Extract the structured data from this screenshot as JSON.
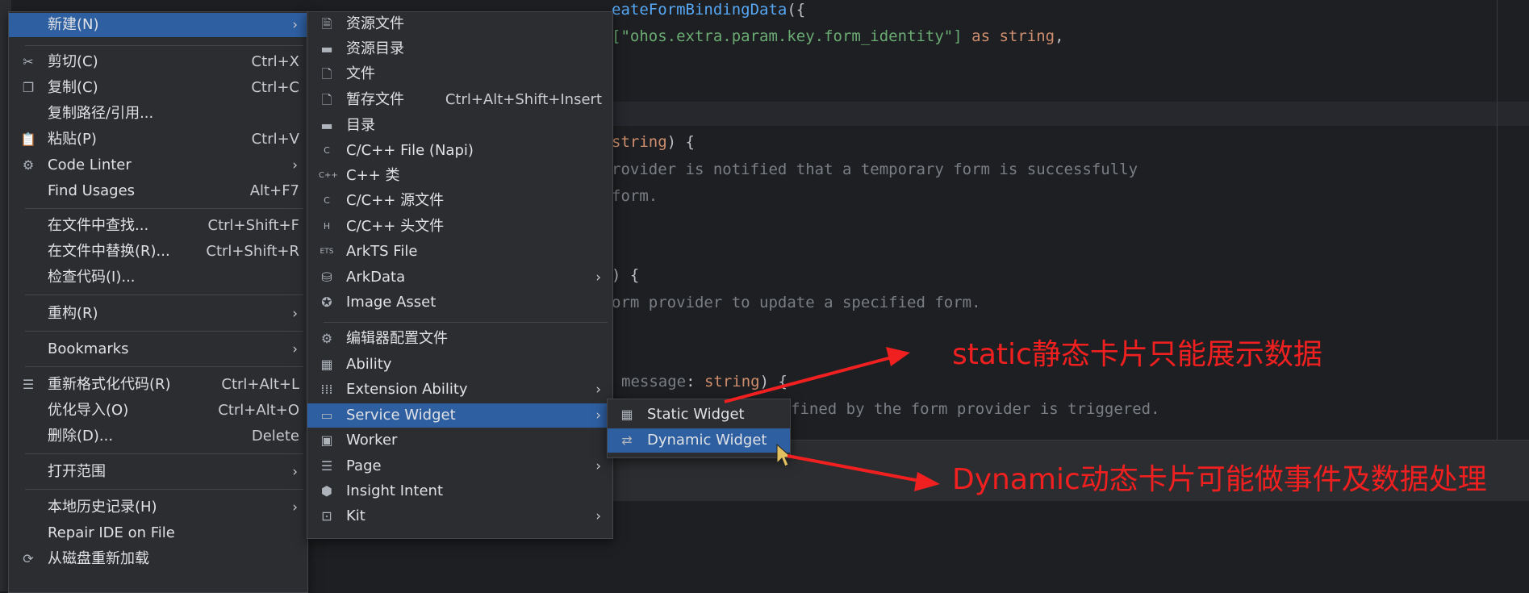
{
  "code": {
    "lines": [
      {
        "pre": "",
        "fn": "eateFormBindingData",
        "post": "({"
      },
      {
        "str": "[\"ohos.extra.param.key.form_identity\"]",
        "kw": " as ",
        "type": "string",
        "end": ","
      },
      {
        "type2": "string",
        "rest": ") {"
      },
      {
        "comment1": "rovider is notified that a temporary form is successfully"
      },
      {
        "comment2": "form."
      },
      {
        "brace": ") {"
      },
      {
        "comment3": "orm provider to update a specified form."
      },
      {
        "msg": "message",
        "colon": ": ",
        "msgtype": "string",
        "msgend": ") {"
      },
      {
        "comment4": "fined by the form provider is triggered."
      }
    ]
  },
  "context_menu": {
    "items": [
      {
        "label": "新建(N)",
        "shortcut": "",
        "submenu": true,
        "selected": true,
        "icon": ""
      },
      {
        "label": "剪切(C)",
        "shortcut": "Ctrl+X",
        "icon": "scissors-icon"
      },
      {
        "label": "复制(C)",
        "shortcut": "Ctrl+C",
        "icon": "copy-icon"
      },
      {
        "label": "复制路径/引用...",
        "shortcut": "",
        "icon": ""
      },
      {
        "label": "粘贴(P)",
        "shortcut": "Ctrl+V",
        "icon": "paste-icon"
      },
      {
        "label": "Code Linter",
        "shortcut": "",
        "submenu": true,
        "icon": "linter-icon"
      },
      {
        "label": "Find Usages",
        "shortcut": "Alt+F7",
        "icon": ""
      },
      {
        "label": "在文件中查找...",
        "shortcut": "Ctrl+Shift+F",
        "icon": ""
      },
      {
        "label": "在文件中替换(R)...",
        "shortcut": "Ctrl+Shift+R",
        "icon": ""
      },
      {
        "label": "检查代码(I)...",
        "shortcut": "",
        "icon": ""
      },
      {
        "label": "重构(R)",
        "shortcut": "",
        "submenu": true,
        "icon": ""
      },
      {
        "label": "Bookmarks",
        "shortcut": "",
        "submenu": true,
        "icon": ""
      },
      {
        "label": "重新格式化代码(R)",
        "shortcut": "Ctrl+Alt+L",
        "icon": "format-icon"
      },
      {
        "label": "优化导入(O)",
        "shortcut": "Ctrl+Alt+O",
        "icon": ""
      },
      {
        "label": "删除(D)...",
        "shortcut": "Delete",
        "icon": ""
      },
      {
        "label": "打开范围",
        "shortcut": "",
        "submenu": true,
        "icon": ""
      },
      {
        "label": "本地历史记录(H)",
        "shortcut": "",
        "submenu": true,
        "icon": ""
      },
      {
        "label": "Repair IDE on File",
        "shortcut": "",
        "icon": ""
      },
      {
        "label": "从磁盘重新加载",
        "shortcut": "",
        "icon": "reload-icon"
      }
    ]
  },
  "new_submenu": {
    "items": [
      {
        "label": "资源文件",
        "shortcut": ""
      },
      {
        "label": "资源目录",
        "shortcut": ""
      },
      {
        "label": "文件",
        "shortcut": ""
      },
      {
        "label": "暂存文件",
        "shortcut": "Ctrl+Alt+Shift+Insert"
      },
      {
        "label": "目录",
        "shortcut": ""
      },
      {
        "label": "C/C++ File (Napi)",
        "shortcut": ""
      },
      {
        "label": "C++ 类",
        "shortcut": ""
      },
      {
        "label": "C/C++ 源文件",
        "shortcut": ""
      },
      {
        "label": "C/C++ 头文件",
        "shortcut": ""
      },
      {
        "label": "ArkTS File",
        "shortcut": ""
      },
      {
        "label": "ArkData",
        "submenu": true
      },
      {
        "label": "Image Asset",
        "shortcut": ""
      },
      {
        "label": "编辑器配置文件",
        "shortcut": ""
      },
      {
        "label": "Ability",
        "shortcut": ""
      },
      {
        "label": "Extension Ability",
        "submenu": true
      },
      {
        "label": "Service Widget",
        "submenu": true,
        "selected": true
      },
      {
        "label": "Worker",
        "shortcut": ""
      },
      {
        "label": "Page",
        "submenu": true
      },
      {
        "label": "Insight Intent",
        "shortcut": ""
      },
      {
        "label": "Kit",
        "submenu": true
      }
    ]
  },
  "widget_submenu": {
    "items": [
      {
        "label": "Static Widget"
      },
      {
        "label": "Dynamic Widget",
        "selected": true
      }
    ]
  },
  "annotations": {
    "static": "static静态卡片只能展示数据",
    "dynamic": "Dynamic动态卡片可能做事件及数据处理"
  },
  "colors": {
    "accent": "#2e5fa1",
    "annotation": "#f02020"
  }
}
